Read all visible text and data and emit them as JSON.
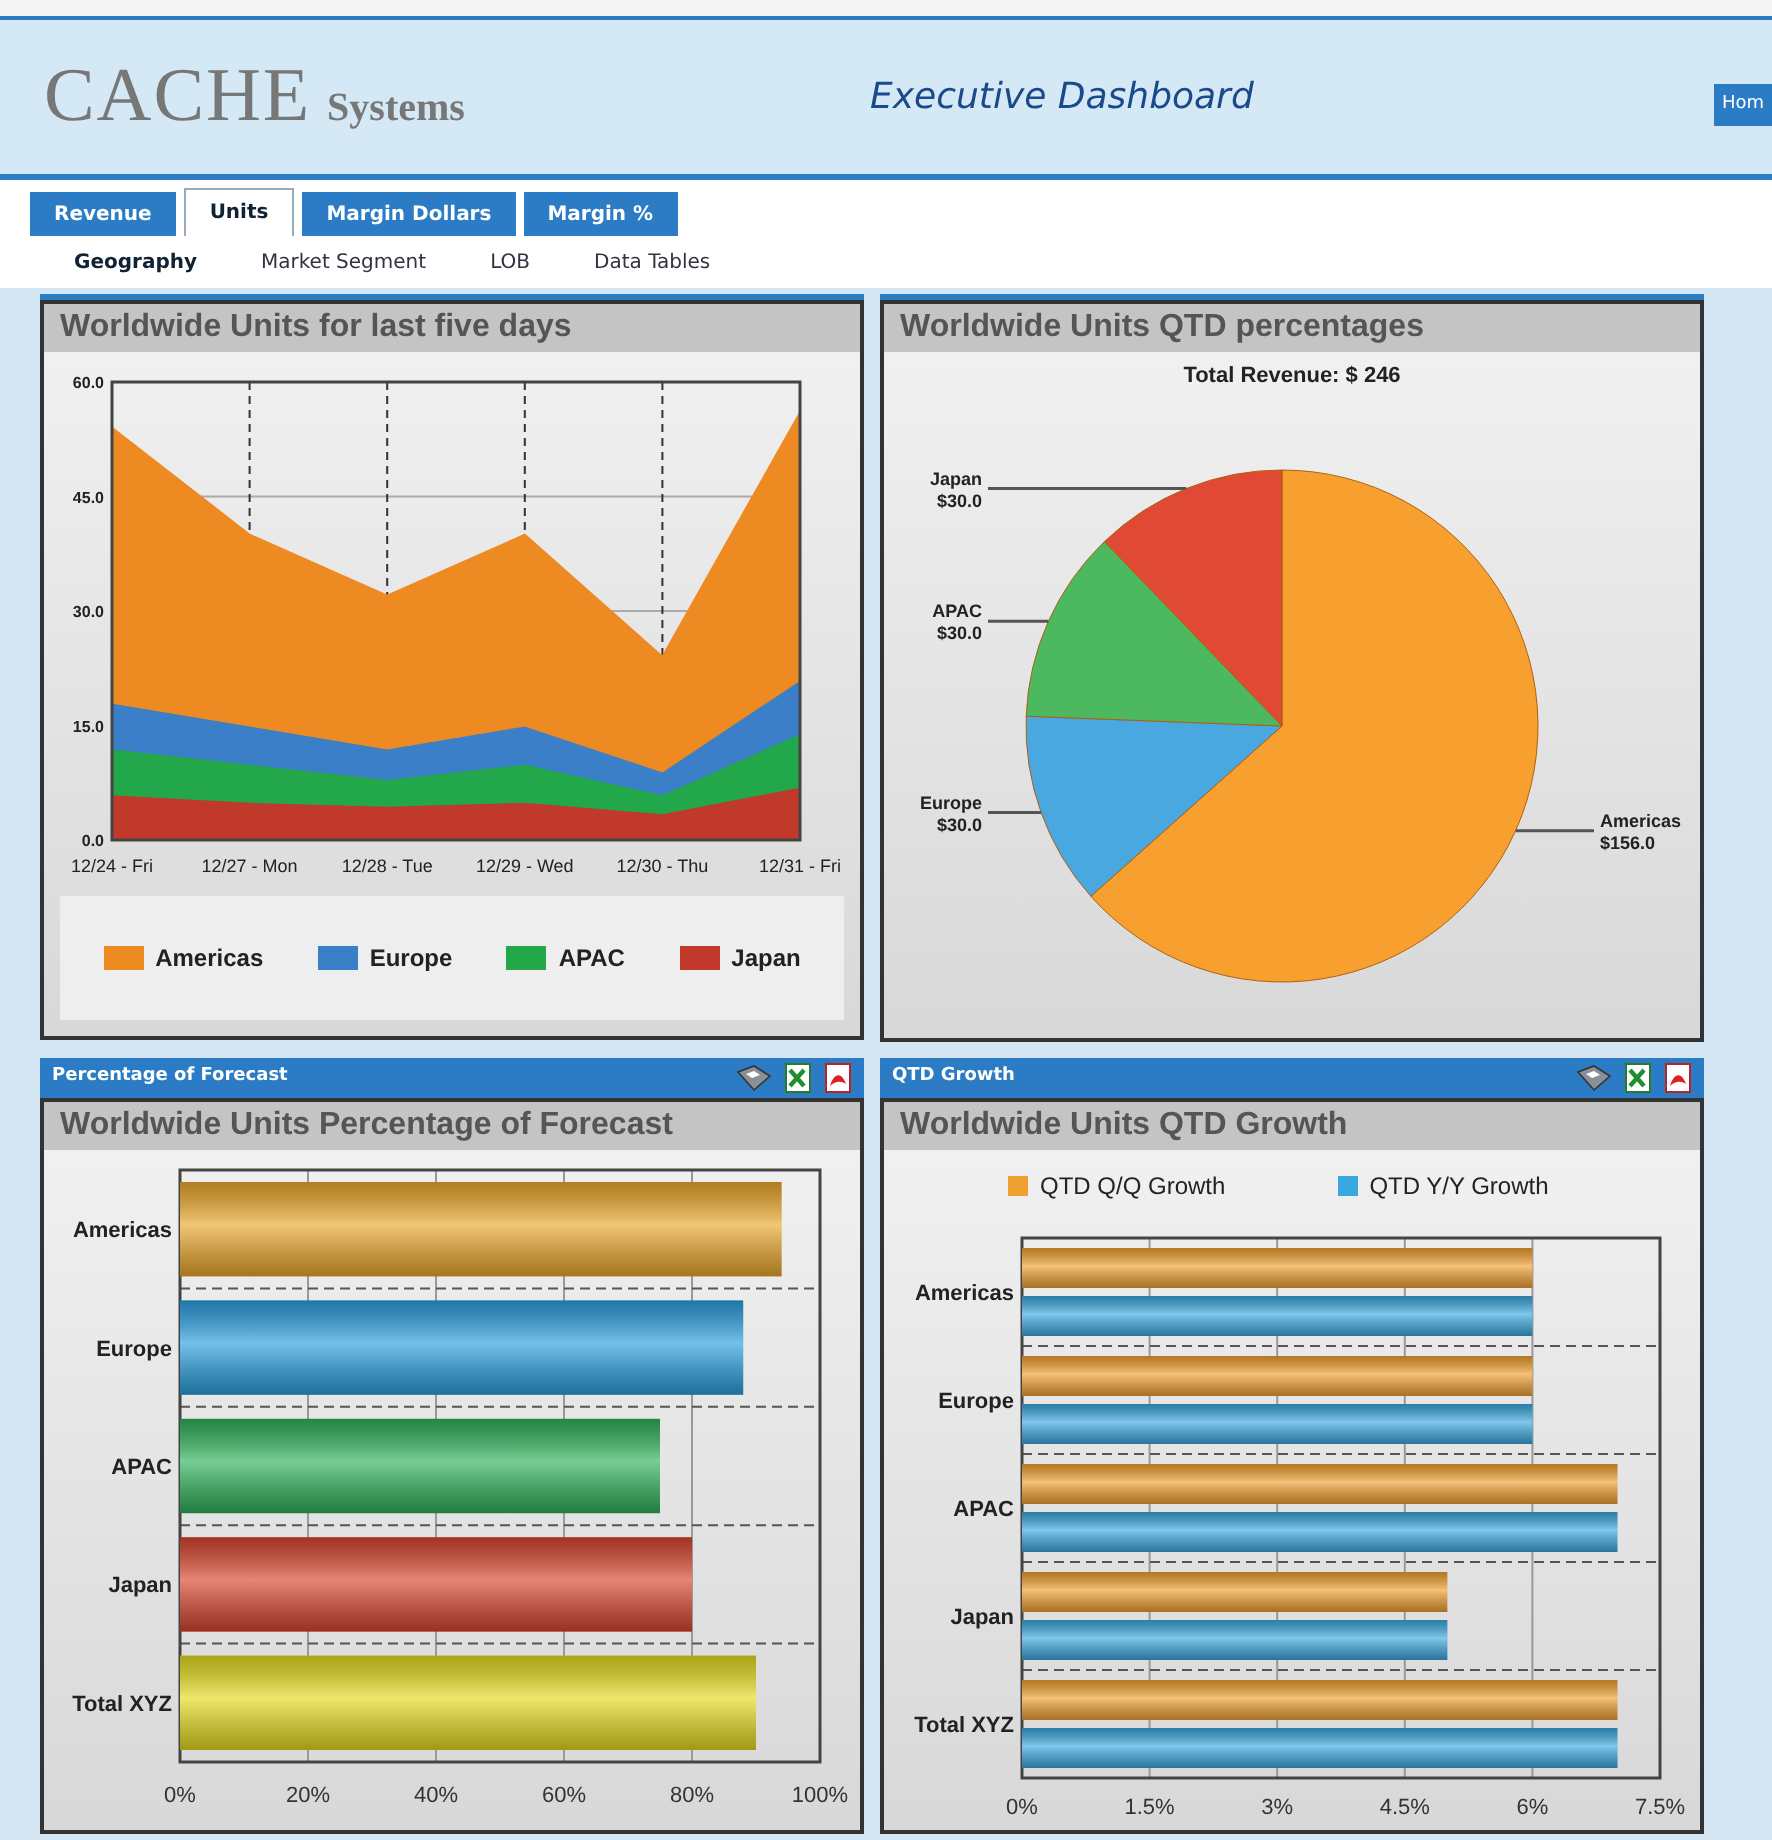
{
  "header": {
    "logo": "CACHE",
    "logo_suffix": "Systems",
    "title": "Executive Dashboard",
    "home_button": "Hom"
  },
  "tabs": [
    {
      "label": "Revenue",
      "selected": false
    },
    {
      "label": "Units",
      "selected": true
    },
    {
      "label": "Margin Dollars",
      "selected": false
    },
    {
      "label": "Margin %",
      "selected": false
    }
  ],
  "subtabs": [
    {
      "label": "Geography",
      "selected": true
    },
    {
      "label": "Market Segment",
      "selected": false
    },
    {
      "label": "LOB",
      "selected": false
    },
    {
      "label": "Data Tables",
      "selected": false
    }
  ],
  "panels": [
    {
      "title": "Worldwide Units for last five days",
      "chart_data": {
        "type": "area",
        "stacked": true,
        "legend": true,
        "grid": true,
        "categories": [
          "12/24 - Fri",
          "12/27 - Mon",
          "12/28 - Tue",
          "12/29 - Wed",
          "12/30 - Thu",
          "12/31 - Fri"
        ],
        "series": [
          {
            "name": "Americas",
            "color": "#ee8a22",
            "values": [
              36,
              25,
              20,
              25,
              15,
              35
            ]
          },
          {
            "name": "Europe",
            "color": "#3a7fc8",
            "values": [
              6,
              5,
              4,
              5,
              3,
              7
            ]
          },
          {
            "name": "APAC",
            "color": "#22a84a",
            "values": [
              6,
              5,
              3.5,
              5,
              2.5,
              7
            ]
          },
          {
            "name": "Japan",
            "color": "#c0392b",
            "values": [
              6,
              5,
              4.5,
              5,
              3.5,
              7
            ]
          }
        ],
        "ylim": [
          0,
          60
        ],
        "yticks": [
          {
            "value": 0,
            "label": "0.0"
          },
          {
            "value": 15,
            "label": "15.0"
          },
          {
            "value": 30,
            "label": "30.0"
          },
          {
            "value": 45,
            "label": "45.0"
          },
          {
            "value": 60,
            "label": "60.0"
          }
        ]
      }
    },
    {
      "title": "Worldwide Units QTD percentages",
      "subtitle": "Total Revenue: $ 246",
      "chart_data": {
        "type": "pie",
        "categories": [
          "Americas",
          "Europe",
          "APAC",
          "Japan"
        ],
        "values": [
          156,
          30,
          30,
          30
        ],
        "colors": [
          "#f7a030",
          "#4aa8e0",
          "#4cb860",
          "#e04a35"
        ],
        "value_labels": [
          "$156.0",
          "$30.0",
          "$30.0",
          "$30.0"
        ]
      }
    },
    {
      "header": "Percentage of Forecast",
      "title": "Worldwide Units Percentage of Forecast",
      "chart_data": {
        "type": "bar",
        "orientation": "horizontal",
        "grid": true,
        "categories": [
          "Americas",
          "Europe",
          "APAC",
          "Japan",
          "Total XYZ"
        ],
        "values": [
          94,
          88,
          75,
          80,
          90
        ],
        "colors": [
          "#eba82c",
          "#2a9fe0",
          "#2eb35a",
          "#d9452e",
          "#e4dc1e"
        ],
        "xlim": [
          0,
          100
        ],
        "xticks": [
          {
            "value": 0,
            "label": "0%"
          },
          {
            "value": 20,
            "label": "20%"
          },
          {
            "value": 40,
            "label": "40%"
          },
          {
            "value": 60,
            "label": "60%"
          },
          {
            "value": 80,
            "label": "80%"
          },
          {
            "value": 100,
            "label": "100%"
          }
        ]
      }
    },
    {
      "header": "QTD Growth",
      "title": "Worldwide Units QTD Growth",
      "chart_data": {
        "type": "bar",
        "orientation": "horizontal",
        "legend": true,
        "grid": true,
        "categories": [
          "Americas",
          "Europe",
          "APAC",
          "Japan",
          "Total XYZ"
        ],
        "series": [
          {
            "name": "QTD Q/Q Growth",
            "color": "#f0a030",
            "values": [
              6,
              6,
              7,
              5,
              7
            ]
          },
          {
            "name": "QTD Y/Y Growth",
            "color": "#3aa8e0",
            "values": [
              6,
              6,
              7,
              5,
              7
            ]
          }
        ],
        "xlim": [
          0,
          7.5
        ],
        "xticks": [
          {
            "value": 0,
            "label": "0%"
          },
          {
            "value": 1.5,
            "label": "1.5%"
          },
          {
            "value": 3,
            "label": "3%"
          },
          {
            "value": 4.5,
            "label": "4.5%"
          },
          {
            "value": 6,
            "label": "6%"
          },
          {
            "value": 7.5,
            "label": "7.5%"
          }
        ]
      }
    }
  ]
}
